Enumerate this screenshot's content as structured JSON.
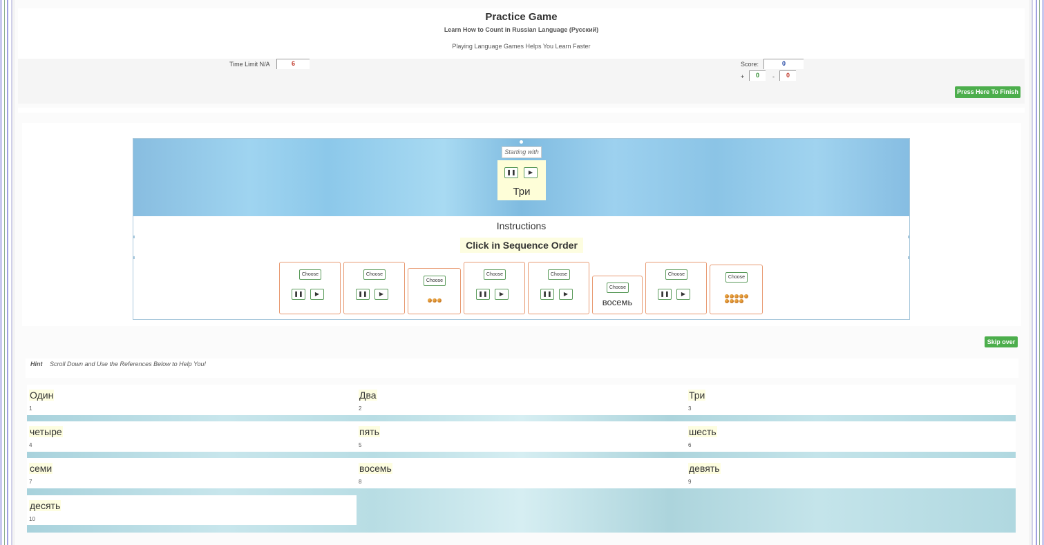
{
  "header": {
    "title": "Practice Game",
    "subtitle": "Learn How to Count in Russian Language (Русский)",
    "tagline": "Playing Language Games Helps You Learn Faster"
  },
  "stats": {
    "time_label": "Time Limit N/A",
    "time_value": "6",
    "score_label": "Score:",
    "score_value": "0",
    "plus_label": "+",
    "plus_value": "0",
    "minus_label": "-",
    "minus_value": "0",
    "finish_label": "Press Here To Finish"
  },
  "game": {
    "starting_with_label": "Starting with",
    "start_word": "Три",
    "pause_icon": "pause-icon",
    "play_icon": "play-icon",
    "instructions_label": "Instructions",
    "sequence_text": "Click in Sequence Order",
    "choose_label": "Choose",
    "cards": [
      {
        "kind": "audio"
      },
      {
        "kind": "audio"
      },
      {
        "kind": "balls",
        "count": 3
      },
      {
        "kind": "audio"
      },
      {
        "kind": "audio"
      },
      {
        "kind": "word",
        "word": "восемь"
      },
      {
        "kind": "audio"
      },
      {
        "kind": "balls",
        "count": 9
      }
    ],
    "skip_label": "Skip over"
  },
  "hint": {
    "label": "Hint",
    "text": "Scroll Down and Use the References Below to Help You!"
  },
  "references": [
    {
      "word": "Один",
      "number": "1"
    },
    {
      "word": "Два",
      "number": "2"
    },
    {
      "word": "Три",
      "number": "3"
    },
    {
      "word": "четыре",
      "number": "4"
    },
    {
      "word": "пять",
      "number": "5"
    },
    {
      "word": "шесть",
      "number": "6"
    },
    {
      "word": "семи",
      "number": "7"
    },
    {
      "word": "восемь",
      "number": "8"
    },
    {
      "word": "девять",
      "number": "9"
    },
    {
      "word": "десять",
      "number": "10"
    }
  ],
  "colors": {
    "button_green": "#4cae4c",
    "card_border": "#e89a72",
    "highlight": "#fdfde0",
    "time_red": "#c0392b",
    "score_blue": "#1a3fa0"
  }
}
